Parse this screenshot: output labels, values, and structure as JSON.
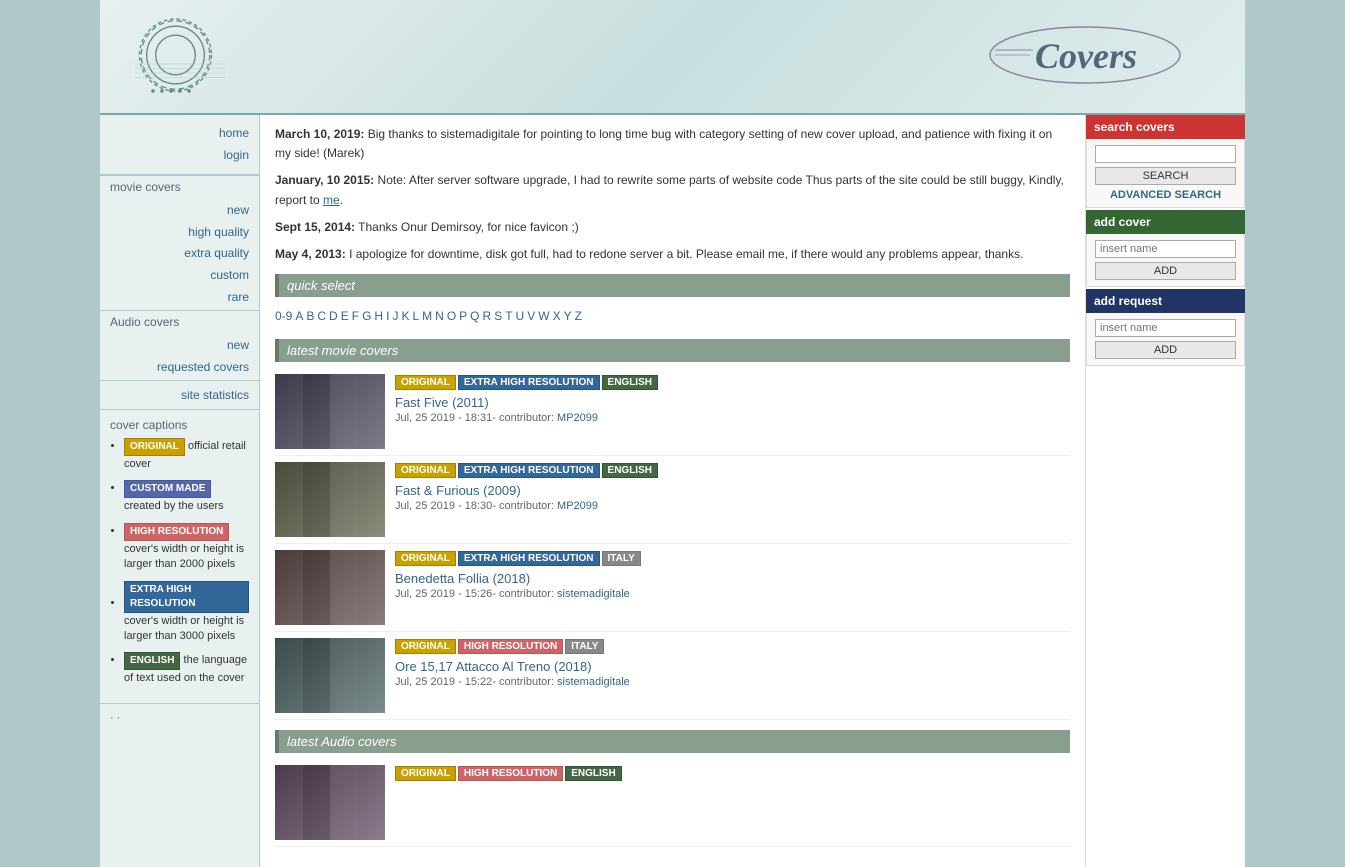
{
  "site": {
    "title": "Covers",
    "logo_text": "Covers"
  },
  "header": {
    "nav": {
      "home": "home",
      "login": "login"
    }
  },
  "sidebar": {
    "movie_covers_label": "movie covers",
    "movie_links": [
      {
        "label": "new",
        "href": "#"
      },
      {
        "label": "high quality",
        "href": "#"
      },
      {
        "label": "extra quality",
        "href": "#"
      },
      {
        "label": "custom",
        "href": "#"
      },
      {
        "label": "rare",
        "href": "#"
      }
    ],
    "audio_covers_label": "Audio covers",
    "audio_links": [
      {
        "label": "new",
        "href": "#"
      },
      {
        "label": "requested covers",
        "href": "#"
      }
    ],
    "site_statistics_label": "site statistics",
    "cover_captions_label": "cover captions",
    "captions": [
      {
        "badge": "ORIGINAL",
        "badge_class": "badge-original",
        "text": "official retail cover"
      },
      {
        "badge": "CUSTOM MADE",
        "badge_class": "badge-custom",
        "text": "created by the users"
      },
      {
        "badge": "HIGH RESOLUTION",
        "badge_class": "badge-high-res",
        "text": "cover's width or height is larger than 2000 pixels"
      },
      {
        "badge": "EXTRA HIGH RESOLUTION",
        "badge_class": "badge-extra-high",
        "text": "cover's width or height is larger than 3000 pixels"
      },
      {
        "badge": "ENGLISH",
        "badge_class": "badge-english",
        "text": "the language of text used on the cover"
      }
    ]
  },
  "news": [
    {
      "date": "March 10, 2019:",
      "text": " Big thanks to sistemadigitale for pointing to long time bug with category setting of new cover upload, and patience with fixing it on my side! (Marek)"
    },
    {
      "date": "January, 10 2015:",
      "text": " Note: After server software upgrade, I had to rewrite some parts of website code Thus parts of the site could be still buggy, Kindly, report to ",
      "link": "me",
      "link_after": "."
    },
    {
      "date": "Sept 15, 2014:",
      "text": " Thanks Onur Demirsoy, for nice favicon ;)"
    },
    {
      "date": "May 4, 2013:",
      "text": " I apologize for downtime, disk got full, had to redone server a bit. Please email me, if there would any problems appear, thanks."
    }
  ],
  "quick_select": {
    "label": "quick select",
    "chars": [
      "0-9",
      "A",
      "B",
      "C",
      "D",
      "E",
      "F",
      "G",
      "H",
      "I",
      "J",
      "K",
      "L",
      "M",
      "N",
      "O",
      "P",
      "Q",
      "R",
      "S",
      "T",
      "U",
      "V",
      "W",
      "X",
      "Y",
      "Z"
    ]
  },
  "latest_movie_covers": {
    "label": "latest movie covers",
    "items": [
      {
        "title": "Fast Five (2011)",
        "date": "Jul, 25 2019 - 18:31-",
        "contributor": "MP2099",
        "badges": [
          {
            "label": "ORIGINAL",
            "class": "badge-original"
          },
          {
            "label": "EXTRA HIGH RESOLUTION",
            "class": "badge-extra-high"
          },
          {
            "label": "ENGLISH",
            "class": "badge-english"
          }
        ],
        "thumb_class": "thumb-fast5"
      },
      {
        "title": "Fast & Furious (2009)",
        "date": "Jul, 25 2019 - 18:30-",
        "contributor": "MP2099",
        "badges": [
          {
            "label": "ORIGINAL",
            "class": "badge-original"
          },
          {
            "label": "EXTRA HIGH RESOLUTION",
            "class": "badge-extra-high"
          },
          {
            "label": "ENGLISH",
            "class": "badge-english"
          }
        ],
        "thumb_class": "thumb-fastfurious"
      },
      {
        "title": "Benedetta Follia (2018)",
        "date": "Jul, 25 2019 - 15:26-",
        "contributor": "sistemadigitale",
        "badges": [
          {
            "label": "ORIGINAL",
            "class": "badge-original"
          },
          {
            "label": "EXTRA HIGH RESOLUTION",
            "class": "badge-extra-high"
          },
          {
            "label": "ITALY",
            "class": "badge-italy"
          }
        ],
        "thumb_class": "thumb-benedetta"
      },
      {
        "title": "Ore 15,17 Attacco Al Treno (2018)",
        "date": "Jul, 25 2019 - 15:22-",
        "contributor": "sistemadigitale",
        "badges": [
          {
            "label": "ORIGINAL",
            "class": "badge-original"
          },
          {
            "label": "HIGH RESOLUTION",
            "class": "badge-high-res"
          },
          {
            "label": "ITALY",
            "class": "badge-italy"
          }
        ],
        "thumb_class": "thumb-ore"
      }
    ]
  },
  "latest_audio_covers": {
    "label": "latest Audio covers",
    "items": [
      {
        "title": "",
        "badges": [
          {
            "label": "ORIGINAL",
            "class": "badge-original"
          },
          {
            "label": "HIGH RESOLUTION",
            "class": "badge-high-res"
          },
          {
            "label": "ENGLISH",
            "class": "badge-english"
          }
        ],
        "thumb_class": "thumb-audio"
      }
    ]
  },
  "search": {
    "label": "search covers",
    "placeholder": "",
    "button": "SEARCH",
    "advanced": "ADVANCED SEARCH"
  },
  "add_cover": {
    "label": "add cover",
    "placeholder": "insert name",
    "button": "ADD"
  },
  "add_request": {
    "label": "add request",
    "placeholder": "insert name",
    "button": "ADD"
  }
}
